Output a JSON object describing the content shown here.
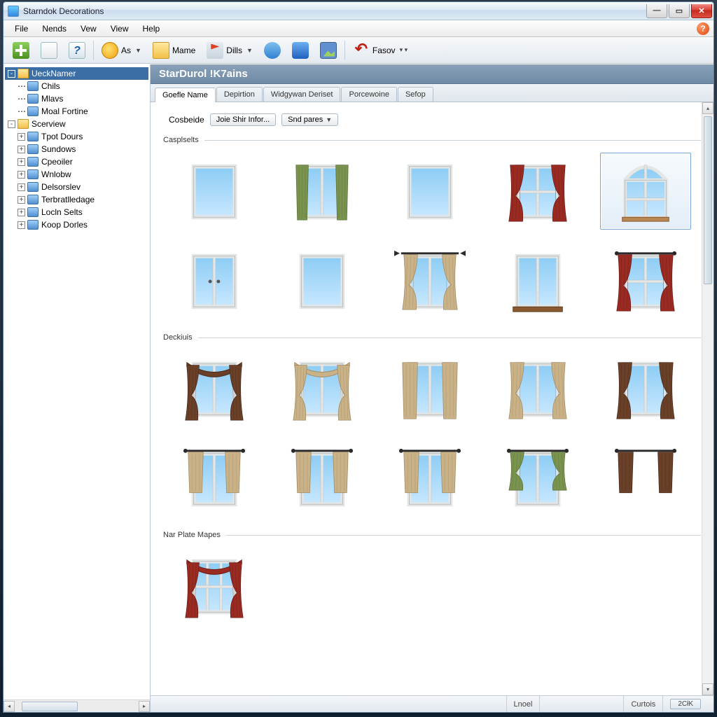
{
  "window": {
    "title": "Starndok Decorations"
  },
  "menubar": [
    "File",
    "Nends",
    "Vew",
    "View",
    "Help"
  ],
  "toolbar": {
    "as": "As",
    "mame": "Mame",
    "dills": "Dills",
    "fasov": "Fasov"
  },
  "sidebar": {
    "root1": {
      "label": "UeckNamer",
      "children": [
        "Chils",
        "Mlavs",
        "Moal Fortine"
      ]
    },
    "root2": {
      "label": "Scerview",
      "children": [
        "Tpot Dours",
        "Sundows",
        "Cpeoiler",
        "Wnlobw",
        "Delsorslev",
        "Terbratlledage",
        "Locln Selts",
        "Koop Dorles"
      ]
    }
  },
  "banner": "StarDurol  !K7ains",
  "tabs": [
    "Goefle Name",
    "Depirtion",
    "Widgywan Deriset",
    "Porcewoine",
    "Sefop"
  ],
  "controls": {
    "label": "Cosbeide",
    "btn1": "Joie Shir Infor...",
    "btn2": "Snd pares"
  },
  "sections": {
    "s1": "Casplselts",
    "s2": "Deckiuis",
    "s3": "Nar Plate Mapes"
  },
  "status": {
    "left": "Lnoel",
    "mid": "Curtois",
    "ok": "2CłK"
  },
  "thumbs": {
    "s1": [
      {
        "name": "window-plain-1",
        "curtain": "none",
        "frame": "white",
        "panes": "single"
      },
      {
        "name": "window-green-drapes",
        "curtain": "green-sides",
        "frame": "white",
        "panes": "2v"
      },
      {
        "name": "window-plain-2",
        "curtain": "none",
        "frame": "white",
        "panes": "single"
      },
      {
        "name": "window-red-tied",
        "curtain": "red-tied",
        "frame": "white",
        "panes": "grid4"
      },
      {
        "name": "window-arched",
        "curtain": "none",
        "frame": "grey-arch",
        "panes": "arch",
        "selected": true
      },
      {
        "name": "window-casement",
        "curtain": "none",
        "frame": "white",
        "panes": "2v-handle"
      },
      {
        "name": "window-tall",
        "curtain": "none",
        "frame": "white",
        "panes": "single"
      },
      {
        "name": "window-tan-open-rod",
        "curtain": "tan-open",
        "frame": "white",
        "panes": "2v",
        "rod": "finial"
      },
      {
        "name": "window-sash",
        "curtain": "none",
        "frame": "brown-sill",
        "panes": "2v"
      },
      {
        "name": "window-red-full",
        "curtain": "red-tied",
        "frame": "white",
        "panes": "grid4",
        "rod": "plain"
      }
    ],
    "s2": [
      {
        "name": "drape-brown-swag",
        "curtain": "brown-swag",
        "frame": "white",
        "panes": "2v"
      },
      {
        "name": "drape-tan-swag",
        "curtain": "tan-swag",
        "frame": "white",
        "panes": "2v"
      },
      {
        "name": "drape-tan-straight",
        "curtain": "tan-panels",
        "frame": "white",
        "panes": "2v"
      },
      {
        "name": "drape-tan-tied",
        "curtain": "tan-tied",
        "frame": "white",
        "panes": "2v"
      },
      {
        "name": "drape-brown-tied",
        "curtain": "brown-tied",
        "frame": "white",
        "panes": "2v"
      },
      {
        "name": "drape-tan-short-1",
        "curtain": "tan-short",
        "frame": "white",
        "panes": "2v",
        "rod": "plain"
      },
      {
        "name": "drape-tan-short-2",
        "curtain": "tan-short",
        "frame": "white",
        "panes": "2v",
        "rod": "plain"
      },
      {
        "name": "drape-tan-short-3",
        "curtain": "tan-short",
        "frame": "white",
        "panes": "2v",
        "rod": "plain"
      },
      {
        "name": "drape-green-tied",
        "curtain": "green-tied-short",
        "frame": "white",
        "panes": "2v",
        "rod": "plain"
      },
      {
        "name": "drape-brown-panels",
        "curtain": "brown-panels-short",
        "frame": "none",
        "panes": "none",
        "rod": "plain"
      }
    ],
    "s3": [
      {
        "name": "plate-red-drape",
        "curtain": "red-swag",
        "frame": "white",
        "panes": "grid6"
      }
    ]
  },
  "colors": {
    "sky1": "#8cccf4",
    "sky2": "#c8e8ff",
    "frame": "#e4e6e6",
    "frameD": "#b8bebe",
    "green": "#7a934f",
    "greenD": "#5c7038",
    "red": "#9a2b22",
    "redD": "#6c1a14",
    "tan": "#c9b188",
    "tanD": "#a48b60",
    "brown": "#6a4028",
    "brownD": "#4a2a18",
    "rod": "#2a2a2a"
  }
}
